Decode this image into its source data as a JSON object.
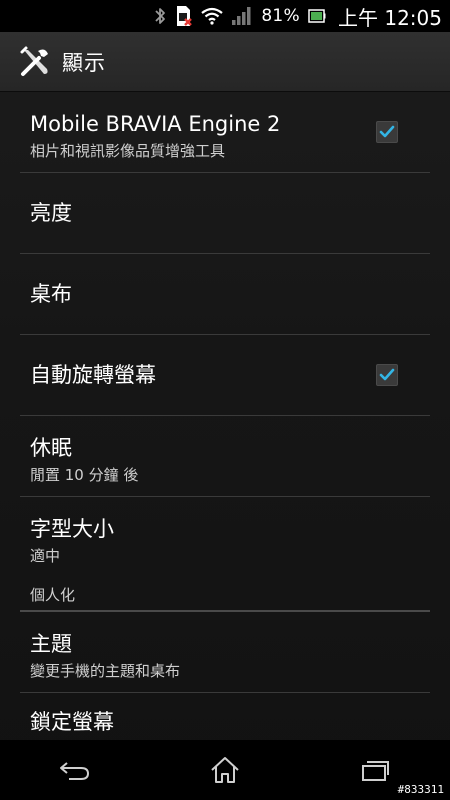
{
  "status_bar": {
    "icons": [
      "bluetooth-icon",
      "sim-error-icon",
      "wifi-icon",
      "signal-icon",
      "battery-icon"
    ],
    "battery_percent": "81%",
    "clock": "上午 12:05"
  },
  "action_bar": {
    "icon": "tools-icon",
    "title": "顯示"
  },
  "settings": {
    "mbe": {
      "title": "Mobile BRAVIA Engine 2",
      "summary": "相片和視訊影像品質增強工具",
      "checked": true
    },
    "brightness": {
      "title": "亮度"
    },
    "wallpaper": {
      "title": "桌布"
    },
    "auto_rotate": {
      "title": "自動旋轉螢幕",
      "checked": true
    },
    "sleep": {
      "title": "休眠",
      "summary": "閒置 10 分鐘 後"
    },
    "font_size": {
      "title": "字型大小",
      "summary": "適中"
    },
    "personalization_category": "個人化",
    "theme": {
      "title": "主題",
      "summary": "變更手機的主題和桌布"
    },
    "lock_screen": {
      "title": "鎖定螢幕"
    }
  },
  "nav_bar": {
    "buttons": [
      "back-icon",
      "home-icon",
      "recent-apps-icon"
    ]
  },
  "watermark": "#833311",
  "colors": {
    "checkbox_check": "#33b5e5",
    "divider": "#3a3a3a",
    "background": "#161616"
  }
}
